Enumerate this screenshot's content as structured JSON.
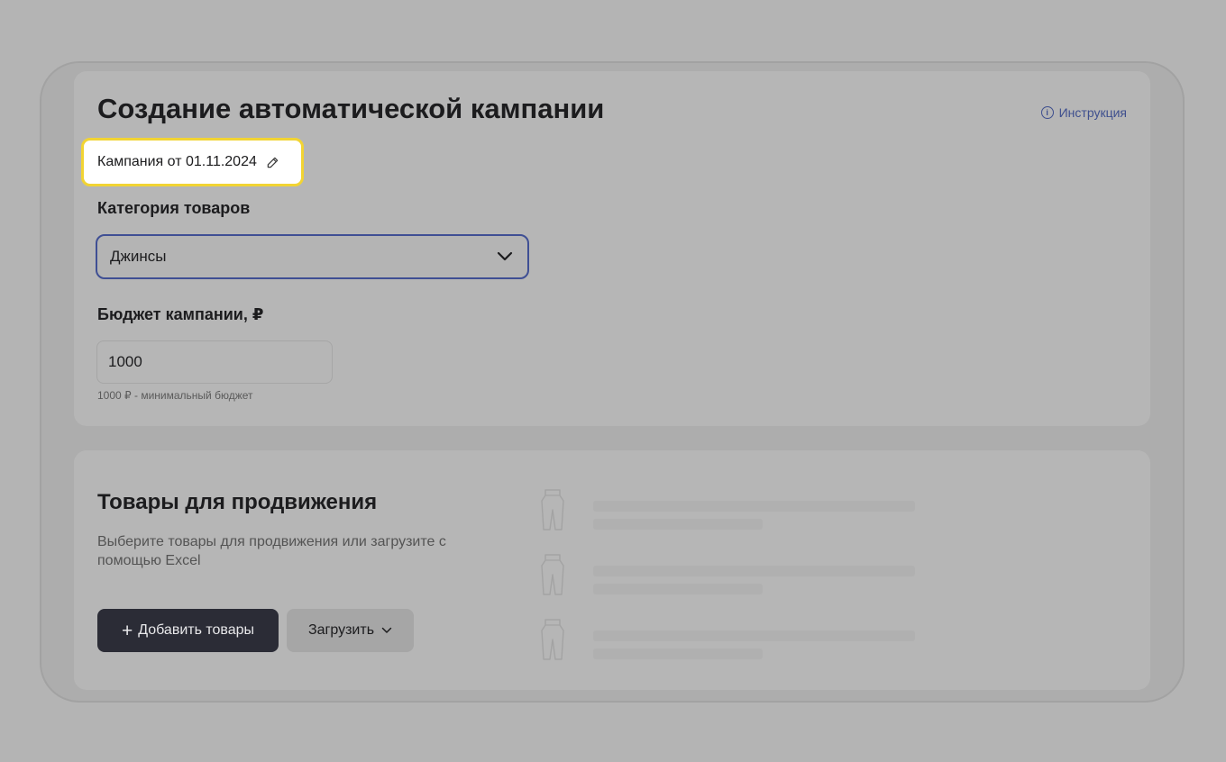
{
  "campaign_form": {
    "title": "Создание автоматической кампании",
    "help_link": "Инструкция",
    "help_icon_glyph": "i",
    "campaign_name": "Кампания от 01.11.2024",
    "category_label": "Категория товаров",
    "category_value": "Джинсы",
    "budget_label": "Бюджет кампании, ₽",
    "budget_value": "1000",
    "budget_hint": "1000 ₽ - минимальный бюджет"
  },
  "products": {
    "title": "Товары для продвижения",
    "description": "Выберите товары для продвижения или загрузите с помощью Excel",
    "add_button_icon": "+",
    "add_button_label": "Добавить товары",
    "upload_button_label": "Загрузить"
  },
  "icons": {
    "help": "info-icon",
    "edit": "pencil-icon",
    "select": "chevron-down-icon",
    "add": "plus-icon",
    "upload_menu": "chevron-down-icon",
    "placeholder": "jeans-outline-icon"
  },
  "colors": {
    "accent": "#3e4f8e",
    "highlight": "#f2d433",
    "primary_button": "#2b2c36",
    "overlay": "#b4b4b4"
  }
}
